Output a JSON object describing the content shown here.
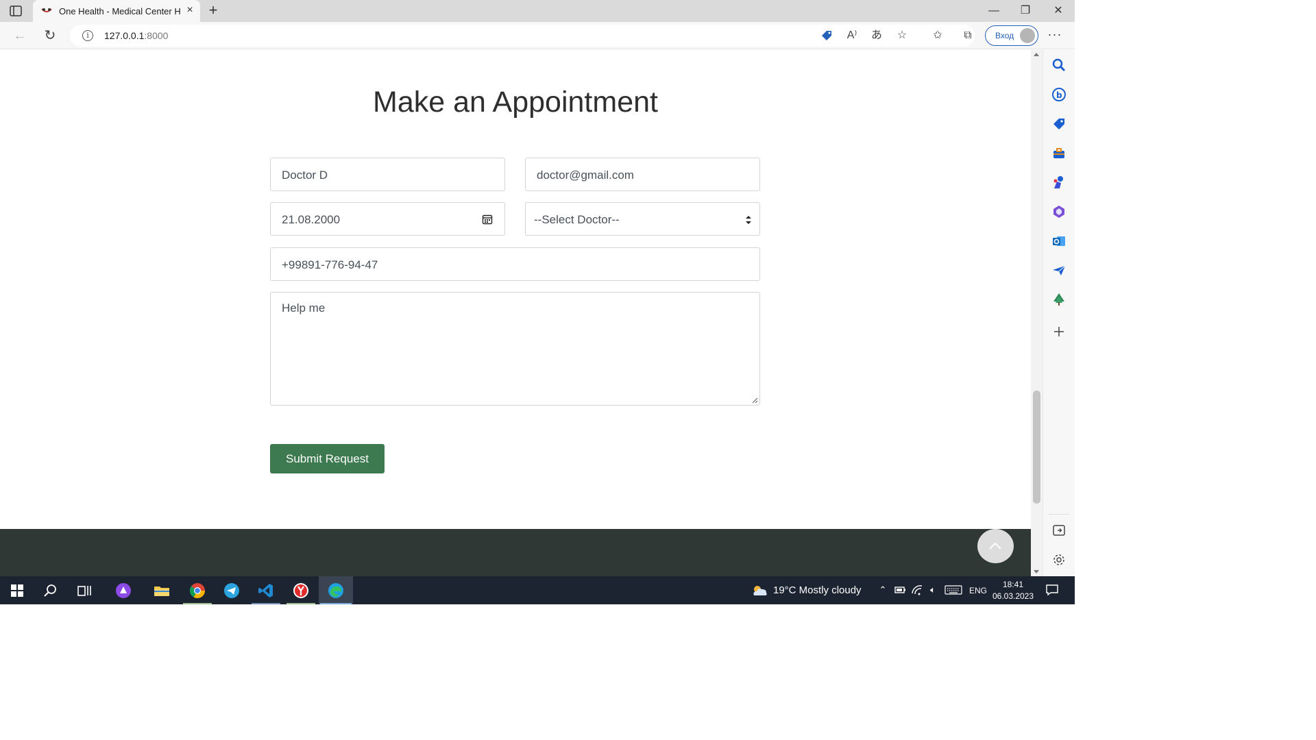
{
  "browser": {
    "tab_title": "One Health - Medical Center HTML",
    "tab_close": "×",
    "new_tab": "+",
    "url_host": "127.0.0.1",
    "url_port": ":8000",
    "info_glyph": "i",
    "login_label": "Вход",
    "more_glyph": "···",
    "window_controls": {
      "minimize": "—",
      "restore": "❐",
      "close": "✕"
    }
  },
  "page": {
    "title": "Make an Appointment",
    "form": {
      "name_value": "Doctor D",
      "email_value": "doctor@gmail.com",
      "date_value": "21.08.2000",
      "doctor_selected": "--Select Doctor--",
      "phone_value": "+99891-776-94-47",
      "message_value": "Help me",
      "submit_label": "Submit Request"
    },
    "colors": {
      "submit": "#3d7a50",
      "footer": "#2f3834"
    }
  },
  "edge_sidebar": {
    "icons": [
      "search-icon",
      "bing-icon",
      "shopping-tag-icon",
      "toolbox-icon",
      "games-icon",
      "office-icon",
      "outlook-icon",
      "send-icon",
      "tree-icon",
      "add-icon",
      "split-screen-icon",
      "settings-icon"
    ]
  },
  "taskbar": {
    "weather": "19°C  Mostly cloudy",
    "language": "ENG",
    "time": "18:41",
    "date": "06.03.2023"
  }
}
